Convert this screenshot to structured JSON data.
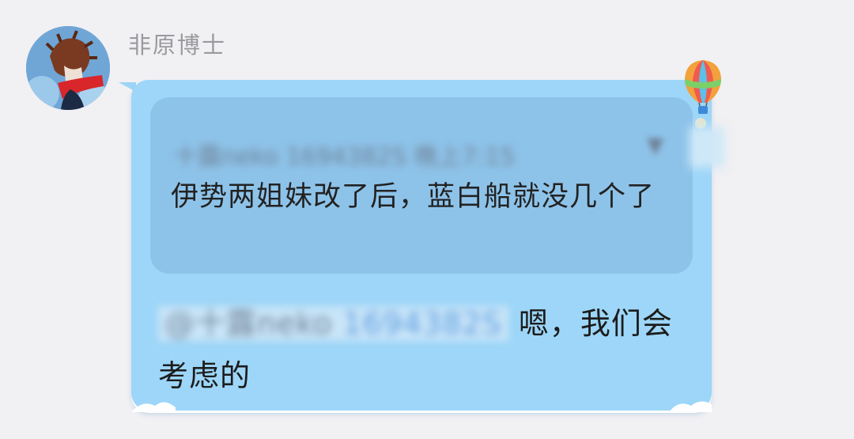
{
  "chat": {
    "sender_name": "非原博士",
    "avatar_icon": "user-avatar-icon",
    "quote": {
      "header": "十露neko 1694382S 晚上7:15",
      "dropdown_symbol": "▼",
      "text": "伊势两姐妹改了后，蓝白船就没几个了"
    },
    "reply": {
      "mention_name": "@十露neko",
      "mention_id": "1694382S",
      "text": "嗯，我们会考虑的"
    }
  },
  "colors": {
    "background": "#f1f0f3",
    "bubble": "#9dd6f8",
    "quote_card": "#8ec3e9",
    "name": "#9a9a9e"
  }
}
